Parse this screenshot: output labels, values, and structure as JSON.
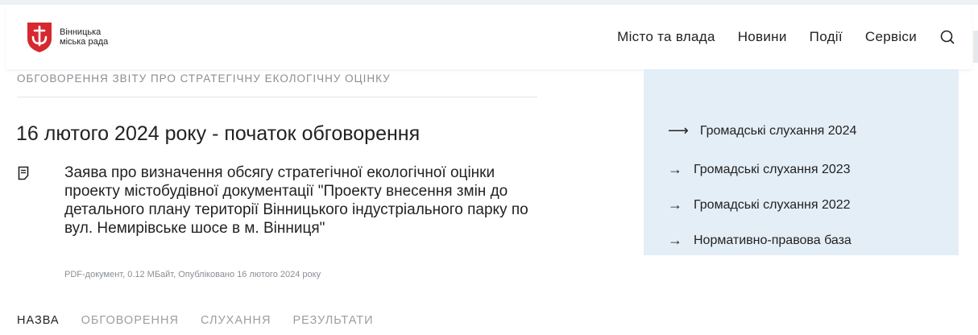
{
  "header": {
    "logo_line1": "Вінницька",
    "logo_line2": "міська рада",
    "nav": [
      "Місто та влада",
      "Новини",
      "Події",
      "Сервіси"
    ]
  },
  "section_label": "ОБГОВОРЕННЯ ЗВІТУ ПРО СТРАТЕГІЧНУ ЕКОЛОГІЧНУ ОЦІНКУ",
  "heading": "16 лютого 2024 року - початок обговорення",
  "document": {
    "title": "Заява про визначення обсягу стратегічної екологічної оцінки проекту містобудівної документації \"Проекту внесення змін до детального плану території Вінницького індустріального парку по вул. Немирівське шосе в м. Вінниця\"",
    "meta": "PDF-документ, 0.12 МБайт, Опубліковано 16 лютого 2024 року"
  },
  "tabs": [
    "НАЗВА",
    "ОБГОВОРЕННЯ",
    "СЛУХАННЯ",
    "РЕЗУЛЬТАТИ"
  ],
  "panel_links": [
    "Громадські слухання 2024",
    "Громадські слухання 2023",
    "Громадські слухання 2022",
    "Нормативно-правова база"
  ],
  "colors": {
    "brand_red": "#d6282f",
    "panel_bg": "#e4eef6"
  }
}
